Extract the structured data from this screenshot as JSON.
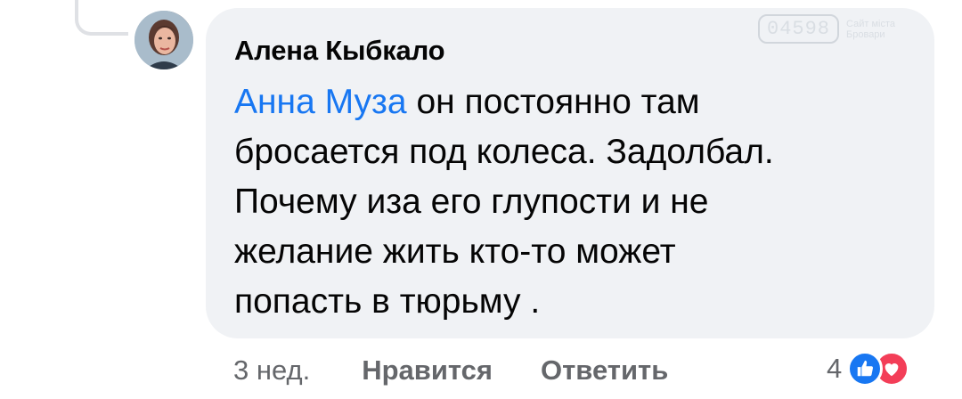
{
  "comment": {
    "author": "Алена Кыбкало",
    "mention": "Анна Муза",
    "text_lines": [
      " он постоянно там",
      "бросается под колеса. Задолбал.",
      "Почему иза его глупости и не",
      "желание жить кто-то может",
      "попасть в тюрьму ."
    ]
  },
  "watermark": {
    "code": "04598",
    "caption_line1": "Сайт міста",
    "caption_line2": "Бровари"
  },
  "actions": {
    "time": "3 нед.",
    "like_label": "Нравится",
    "reply_label": "Ответить"
  },
  "reactions": {
    "count": "4",
    "icons": [
      "like-icon",
      "love-icon"
    ],
    "colors": {
      "like": "#1877f2",
      "love": "#f33e58"
    }
  },
  "colors": {
    "bubble_bg": "#f0f2f5",
    "mention": "#1877f2",
    "text": "#050505",
    "secondary": "#65676b"
  }
}
